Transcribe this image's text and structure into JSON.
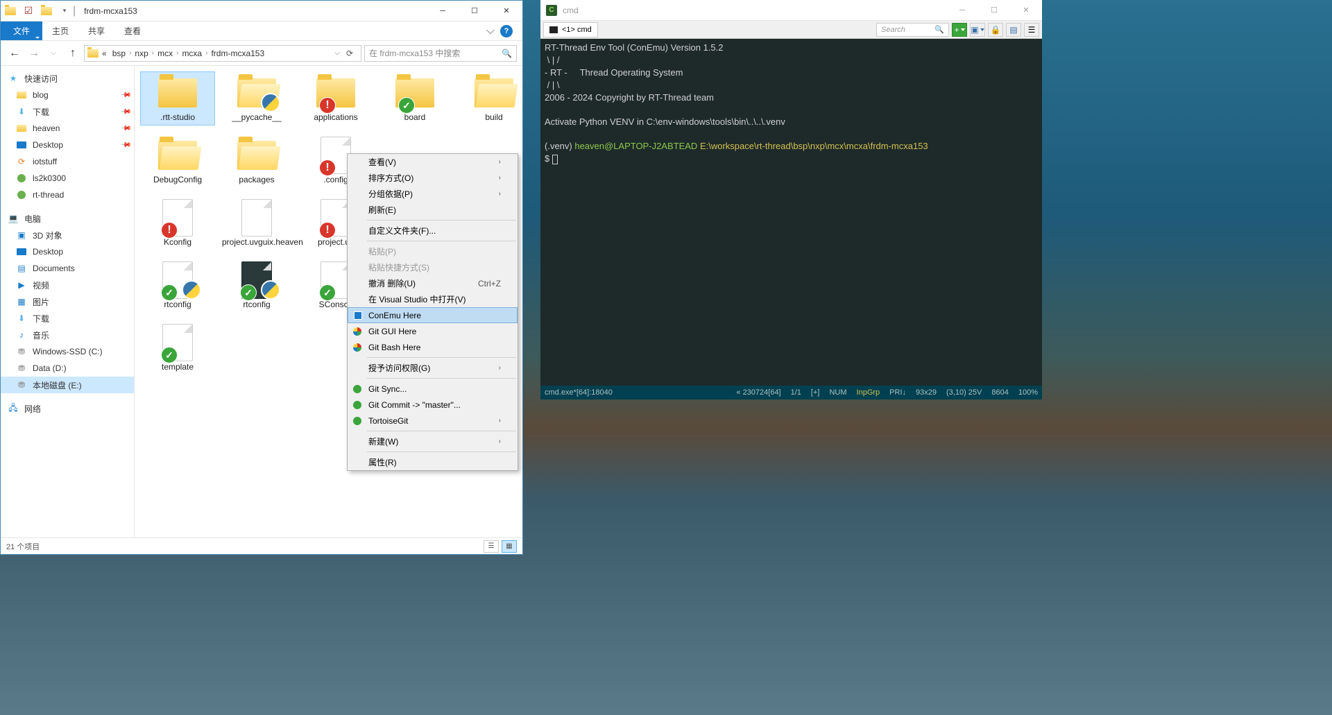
{
  "explorer": {
    "title": "frdm-mcxa153",
    "ribbon": {
      "file": "文件",
      "home": "主页",
      "share": "共享",
      "view": "查看"
    },
    "breadcrumbs": [
      "«",
      "bsp",
      "nxp",
      "mcx",
      "mcxa",
      "frdm-mcxa153"
    ],
    "search_placeholder": "在 frdm-mcxa153 中搜索",
    "sidebar": {
      "quick": "快速访问",
      "items1": [
        "blog",
        "下载",
        "heaven",
        "Desktop",
        "iotstuff",
        "ls2k0300",
        "rt-thread"
      ],
      "pc": "电脑",
      "items2": [
        "3D 对象",
        "Desktop",
        "Documents",
        "视频",
        "图片",
        "下载",
        "音乐",
        "Windows-SSD (C:)",
        "Data (D:)",
        "本地磁盘 (E:)"
      ],
      "net": "网络"
    },
    "files": [
      {
        "name": ".rtt-studio",
        "type": "folder",
        "selected": true
      },
      {
        "name": "__pycache__",
        "type": "folder-py"
      },
      {
        "name": "applications",
        "type": "folder",
        "ovl": "red"
      },
      {
        "name": "board",
        "type": "folder",
        "ovl": "green"
      },
      {
        "name": "build",
        "type": "folder-open"
      },
      {
        "name": "DebugConfig",
        "type": "folder-open"
      },
      {
        "name": "packages",
        "type": "folder-open"
      },
      {
        "name": ".config",
        "type": "file",
        "ovl": "red"
      },
      {
        "name": "Kconfig",
        "type": "file",
        "ovl": "red"
      },
      {
        "name": "project.uvguix.heaven",
        "type": "file"
      },
      {
        "name": "project.uv",
        "type": "file",
        "ovl": "red"
      },
      {
        "name": "rtconfig",
        "type": "py",
        "ovl": "green"
      },
      {
        "name": "rtconfig",
        "type": "py-dark",
        "ovl": "green"
      },
      {
        "name": "SConscri",
        "type": "file",
        "ovl": "green"
      },
      {
        "name": "template",
        "type": "file",
        "ovl": "green"
      }
    ],
    "status": "21 个项目"
  },
  "context_menu": {
    "view": "查看(V)",
    "sort": "排序方式(O)",
    "group": "分组依据(P)",
    "refresh": "刷新(E)",
    "customize": "自定义文件夹(F)...",
    "paste": "粘贴(P)",
    "paste_shortcut": "粘贴快捷方式(S)",
    "undo_delete": "撤消 删除(U)",
    "undo_shortcut": "Ctrl+Z",
    "vs_open": "在 Visual Studio 中打开(V)",
    "conemu": "ConEmu Here",
    "git_gui": "Git GUI Here",
    "git_bash": "Git Bash Here",
    "grant": "授予访问权限(G)",
    "git_sync": "Git Sync...",
    "git_commit": "Git Commit -> \"master\"...",
    "tortoise": "TortoiseGit",
    "new": "新建(W)",
    "props": "属性(R)"
  },
  "conemu": {
    "title": "cmd",
    "tab": "<1> cmd",
    "search": "Search",
    "terminal": {
      "l1": "RT-Thread Env Tool (ConEmu) Version 1.5.2",
      "l2": " \\ | /",
      "l3": "- RT -     Thread Operating System",
      "l4": " / | \\",
      "l5": "2006 - 2024 Copyright by RT-Thread team",
      "l6": "",
      "l7": "Activate Python VENV in C:\\env-windows\\tools\\bin\\..\\..\\.venv",
      "l8": "",
      "venv": "(.venv) ",
      "user": "heaven@LAPTOP-J2ABTEAD ",
      "path": "E:\\workspace\\rt-thread\\bsp\\nxp\\mcx\\mcxa\\frdm-mcxa153",
      "prompt": "$ "
    },
    "status": {
      "left": "cmd.exe*[64]:18040",
      "s1": "« 230724[64]",
      "s2": "1/1",
      "s3": "[+]",
      "s4": "NUM",
      "s5": "InpGrp",
      "s6": "PRI↓",
      "s7": "93x29",
      "s8": "(3,10) 25V",
      "s9": "8604",
      "s10": "100%"
    }
  }
}
